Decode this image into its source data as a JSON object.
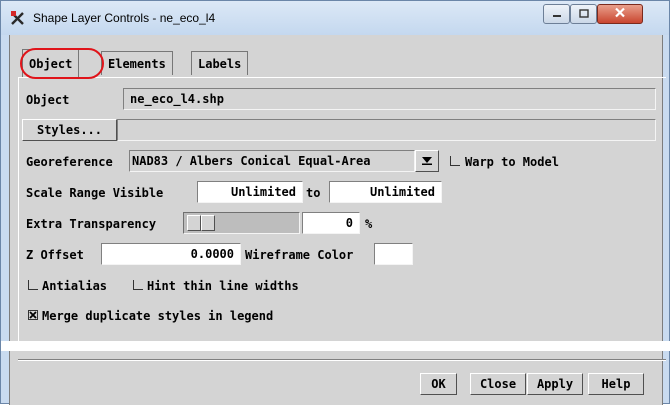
{
  "window": {
    "title": "Shape Layer Controls - ne_eco_l4",
    "app_icon": "tntmips-app-icon",
    "controls": [
      "minimize-icon",
      "maximize-icon",
      "close-icon"
    ]
  },
  "tabs": [
    {
      "label": "Object",
      "active": true
    },
    {
      "label": "Elements",
      "active": false
    },
    {
      "label": "Labels",
      "active": false
    }
  ],
  "object": {
    "label": "Object",
    "value": "ne_eco_l4.shp"
  },
  "styles": {
    "button_label": "Styles...",
    "value": ""
  },
  "georeference": {
    "label": "Georeference",
    "selected": "NAD83 / Albers Conical Equal-Area",
    "warp_label": "Warp to Model",
    "warp_checked": false
  },
  "scale_range": {
    "label": "Scale Range Visible",
    "min": "Unlimited",
    "to_label": "to",
    "max": "Unlimited"
  },
  "transparency": {
    "label": "Extra Transparency",
    "value": "0",
    "unit": "%",
    "level_fraction": 0.0
  },
  "z_offset": {
    "label": "Z Offset",
    "value": "0.0000",
    "wireframe_label": "Wireframe Color"
  },
  "options": {
    "antialias_label": "Antialias",
    "antialias_checked": false,
    "hint_label": "Hint thin line widths",
    "hint_checked": false,
    "merge_label": "Merge duplicate styles in legend",
    "merge_checked": true
  },
  "footer": {
    "ok": "OK",
    "close": "Close",
    "apply": "Apply",
    "help": "Help"
  },
  "colors": {
    "highlight_ring": "#e0141a",
    "window_chrome": "#c9dbf0",
    "dialog_face": "#d4d4d4"
  }
}
